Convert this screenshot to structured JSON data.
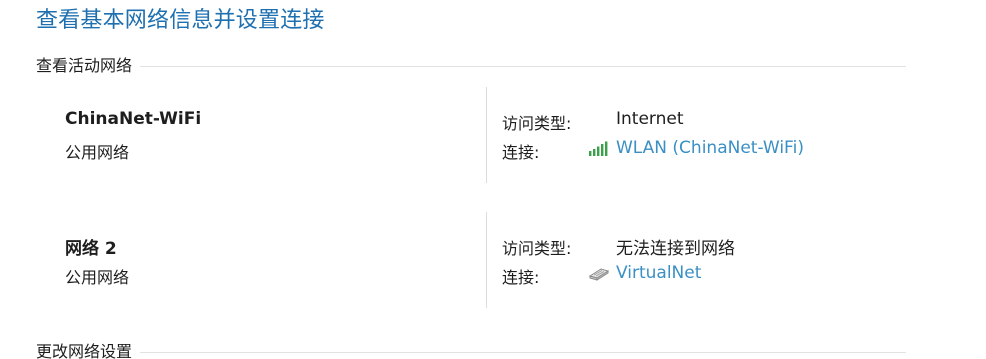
{
  "page": {
    "title": "查看基本网络信息并设置连接"
  },
  "sections": {
    "active_networks": "查看活动网络",
    "change_settings": "更改网络设置"
  },
  "networks": [
    {
      "name": "ChinaNet-WiFi",
      "profile": "公用网络",
      "access_type_label": "访问类型:",
      "access_type_value": "Internet",
      "connection_label": "连接:",
      "connection_value": "WLAN (ChinaNet-WiFi)",
      "connection_icon": "wifi-signal-icon"
    },
    {
      "name": "网络 2",
      "profile": "公用网络",
      "access_type_label": "访问类型:",
      "access_type_value": "无法连接到网络",
      "connection_label": "连接:",
      "connection_value": "VirtualNet",
      "connection_icon": "ethernet-adapter-icon"
    }
  ],
  "colors": {
    "title": "#1e6fb0",
    "link": "#3a8fc4",
    "signal": "#3aa04a"
  }
}
